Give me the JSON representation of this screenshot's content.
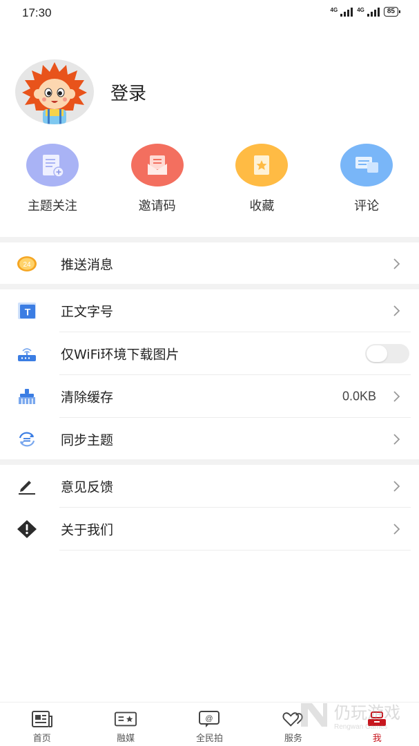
{
  "status_bar": {
    "time": "17:30",
    "network1": "4G",
    "network2": "4G",
    "battery": "85"
  },
  "profile": {
    "login_label": "登录"
  },
  "quick_actions": [
    {
      "label": "主题关注",
      "icon": "subject-follow-icon",
      "color": "#a9b3f5"
    },
    {
      "label": "邀请码",
      "icon": "invite-code-icon",
      "color": "#f36f5f"
    },
    {
      "label": "收藏",
      "icon": "favorites-icon",
      "color": "#ffbb44"
    },
    {
      "label": "评论",
      "icon": "comment-icon",
      "color": "#79b6f8"
    }
  ],
  "menu": {
    "push": {
      "label": "推送消息",
      "icon": "push-badge-icon",
      "badge": "24"
    },
    "font_size": {
      "label": "正文字号",
      "icon": "font-size-icon",
      "glyph": "T"
    },
    "wifi_images": {
      "label": "仅WiFi环境下载图片",
      "icon": "router-icon",
      "toggle_on": false
    },
    "clear_cache": {
      "label": "清除缓存",
      "icon": "broom-icon",
      "value": "0.0KB"
    },
    "sync_theme": {
      "label": "同步主题",
      "icon": "sync-icon"
    },
    "feedback": {
      "label": "意见反馈",
      "icon": "pencil-icon"
    },
    "about": {
      "label": "关于我们",
      "icon": "warning-diamond-icon"
    }
  },
  "tabbar": [
    {
      "label": "首页",
      "icon": "home-news-icon",
      "active": false
    },
    {
      "label": "融媒",
      "icon": "media-icon",
      "active": false
    },
    {
      "label": "全民拍",
      "icon": "camera-at-icon",
      "active": false
    },
    {
      "label": "服务",
      "icon": "service-heart-icon",
      "active": false
    },
    {
      "label": "我",
      "icon": "me-icon",
      "active": true
    }
  ],
  "watermark": {
    "title": "仍玩游戏",
    "subtitle": "Rengwan Games"
  },
  "colors": {
    "accent": "#c8161e",
    "separator": "#f2f2f2"
  }
}
